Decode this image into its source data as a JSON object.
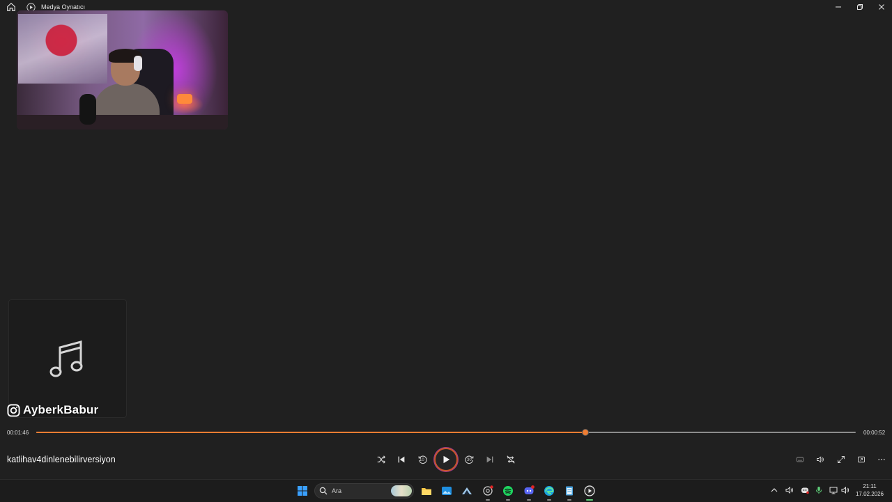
{
  "window": {
    "title": "Medya Oynatıcı"
  },
  "overlay": {
    "instagram_handle": "AyberkBabur"
  },
  "player": {
    "elapsed": "00:01:46",
    "remaining": "00:00:52",
    "progress": 0.67,
    "track_title": "katlihav4dinlenebilirversiyon",
    "state": "paused",
    "accent_color": "#ef7d32"
  },
  "controls": {
    "left": [
      "shuffle-icon",
      "previous-icon",
      "skip-back-10-icon",
      "play-icon",
      "skip-forward-30-icon",
      "next-icon",
      "repeat-off-icon"
    ],
    "skip_back_label": "10",
    "skip_forward_label": "30",
    "right": [
      "subtitles-icon",
      "volume-icon",
      "fullscreen-icon",
      "miniplayer-icon",
      "more-icon"
    ]
  },
  "taskbar": {
    "search_placeholder": "Ara",
    "apps": [
      "windows-start-icon",
      "file-explorer-icon",
      "photos-icon",
      "steam-icon",
      "chatgpt-icon",
      "spotify-icon",
      "discord-icon",
      "edge-icon",
      "notepad-icon",
      "media-player-icon"
    ],
    "tray": [
      "chevron-up-icon",
      "speaker-icon",
      "discord-tray-icon",
      "microphone-icon",
      "network-icon",
      "volume-icon"
    ],
    "time": "21:11",
    "date": "17.02.2026"
  }
}
